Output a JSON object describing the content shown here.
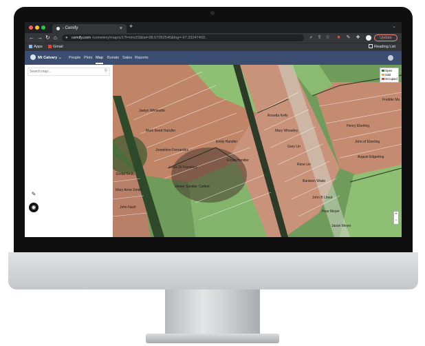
{
  "browser": {
    "tab_title": "- Cemify",
    "url_host": "cemify.com",
    "url_path": "/cemetery/map/s/1?l=r/m/23&lat=38.67052546&lng=-97.33247403..",
    "update_label": "Update",
    "bookmarks": [
      {
        "label": "Apps",
        "icon": "apps-grid-icon"
      },
      {
        "label": "Gmail",
        "icon": "gmail-icon"
      }
    ],
    "reading_list_label": "Reading List"
  },
  "app": {
    "org_name": "Mt Calvary",
    "nav_items": [
      "People",
      "Plots",
      "Map",
      "Burials",
      "Sales",
      "Reports"
    ],
    "active_nav": "Map",
    "search_placeholder": "Search map..."
  },
  "map": {
    "legend": [
      {
        "label": "Open",
        "color": "#2e7d32"
      },
      {
        "label": "Sold",
        "color": "#f6a623"
      },
      {
        "label": "Occupied",
        "color": "#d04a2a"
      }
    ],
    "zoom_in": "+",
    "zoom_out": "−",
    "plot_labels": [
      "Jaelyn Whiteside",
      "Mark Reed Handler",
      "Josephine Fernandes",
      "Emily Handler",
      "Louis Di Francisco",
      "Elmer Handler",
      "Jimmy Sandler Carlton",
      "Rosetta Kelly",
      "Mary Wheatley",
      "Gary Lin",
      "Rene Lin",
      "Bardeen Wade",
      "John B Lhoot",
      "Pear Meyer",
      "Jason Meyer",
      "Freddie Mu",
      "Henry Eberling",
      "John of Eberling",
      "August Edgerting",
      "Sheila Smith",
      "Mary Anne Smith",
      "John Nash"
    ]
  },
  "colors": {
    "nav_bg": "#3b4e71",
    "plot_occupied": "#c08466",
    "plot_open": "#84b46c"
  }
}
